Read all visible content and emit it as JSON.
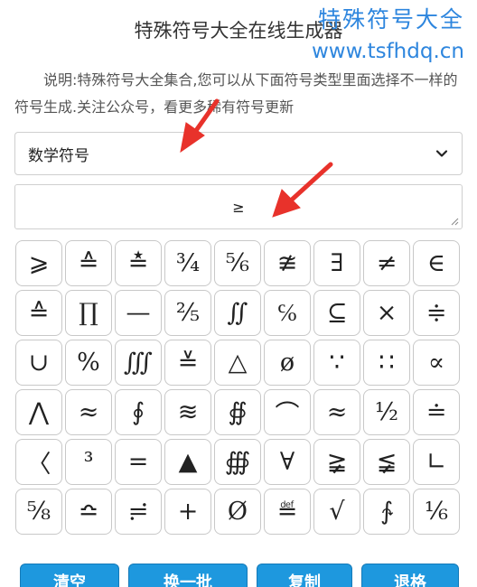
{
  "header": {
    "title": "特殊符号大全在线生成器",
    "watermark_name": "特殊符号大全",
    "watermark_url": "www.tsfhdq.cn"
  },
  "description": "说明:特殊符号大全集合,您可以从下面符号类型里面选择不一样的符号生成.关注公众号，看更多稀有符号更新",
  "category_select": {
    "selected": "数学符号"
  },
  "output": {
    "value": "≥"
  },
  "symbols": [
    "⩾",
    "≙",
    "≛",
    "¾",
    "⅚",
    "≇",
    "∃",
    "≠",
    "∈",
    "≙",
    "∏",
    "—",
    "⅖",
    "∬",
    "℅",
    "⊆",
    "×",
    "≑",
    "∪",
    "%",
    "∭",
    "≚",
    "△",
    "ø",
    "∵",
    "∷",
    "∝",
    "⋀",
    "≈",
    "∮",
    "≋",
    "∯",
    "⌒",
    "≈",
    "½",
    "≐",
    "〈",
    "³",
    "=",
    "▲",
    "∰",
    "∀",
    "≩",
    "≨",
    "∟",
    "⅝",
    "≏",
    "≓",
    "+",
    "Ø",
    "≝",
    "√",
    "∱",
    "⅙"
  ],
  "buttons": {
    "clear": "清空",
    "refresh": "换一批",
    "copy": "复制",
    "back": "退格"
  },
  "colors": {
    "accent": "#1e98de",
    "watermark": "#2e86de",
    "arrow": "#e8322b"
  }
}
